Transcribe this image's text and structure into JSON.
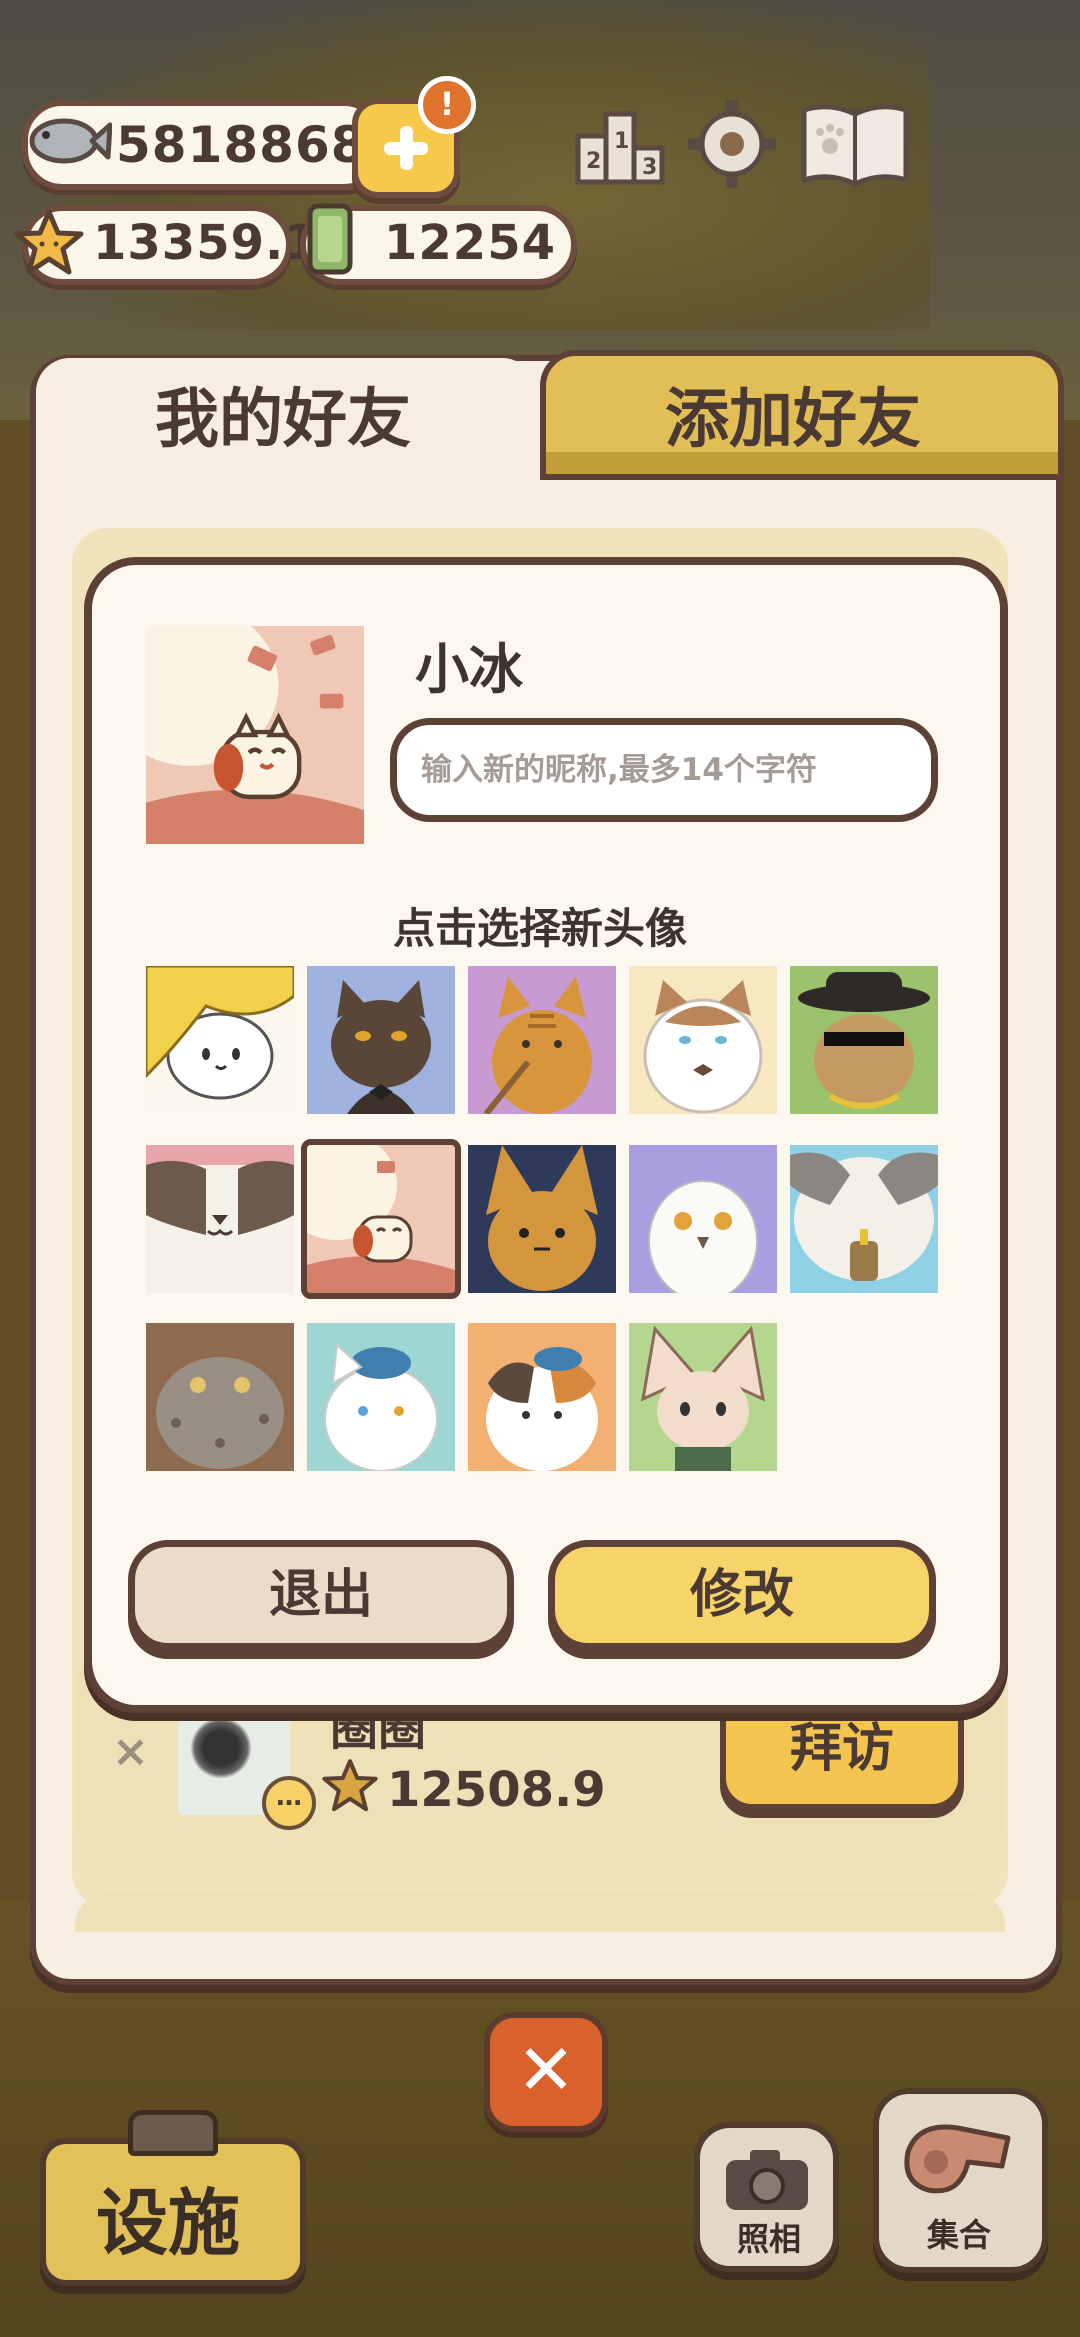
{
  "hud": {
    "fish_count": "5818868",
    "alert_badge": "!",
    "stars": "13359.1",
    "tickets": "12254"
  },
  "tabs": {
    "my_friends": "我的好友",
    "add_friend": "添加好友",
    "active": "my_friends"
  },
  "friend_row": {
    "remove": "×",
    "name": "圈圈",
    "stars": "12508.9",
    "chat": "…",
    "visit_label": "拜访"
  },
  "dialog": {
    "nickname": "小冰",
    "nickname_input_value": "",
    "nickname_placeholder": "输入新的昵称,最多14个字符",
    "choose_title": "点击选择新头像",
    "selected_avatar_index": 6,
    "avatars": [
      {
        "name": "blonde-hair-cat"
      },
      {
        "name": "black-tuxedo-cat"
      },
      {
        "name": "orange-tabby-cat"
      },
      {
        "name": "fluffy-white-cat"
      },
      {
        "name": "sunglasses-hat-cat"
      },
      {
        "name": "white-cat-closeup"
      },
      {
        "name": "lucky-cat"
      },
      {
        "name": "lynx-cat"
      },
      {
        "name": "snowy-owl"
      },
      {
        "name": "grey-white-cat"
      },
      {
        "name": "grey-wild-cat"
      },
      {
        "name": "white-cap-cat"
      },
      {
        "name": "calico-cap-cat"
      },
      {
        "name": "fennec-cat"
      }
    ],
    "exit_label": "退出",
    "modify_label": "修改"
  },
  "bottom": {
    "close": "✕",
    "facility_label": "设施",
    "photo_label": "照相",
    "gather_label": "集合"
  },
  "colors": {
    "border_brown": "#5d4036",
    "accent_yellow": "#f6d46a",
    "panel_cream": "#f5eee1",
    "close_orange": "#d9622c"
  }
}
